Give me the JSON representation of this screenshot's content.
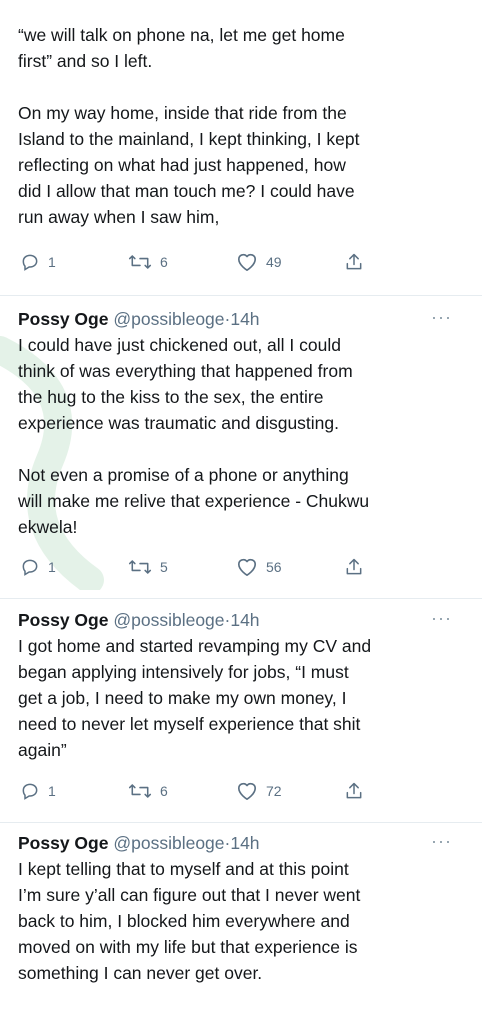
{
  "intro": {
    "line1": "“we will talk on phone na, let me get home\nfirst” and so I left.",
    "line2": "On my way home, inside that ride from the\nIsland to the mainland, I kept thinking, I kept\nreflecting on what had just happened, how\ndid I allow that man touch me? I could have\nrun away when I saw him,"
  },
  "intro_actions": {
    "replies": "1",
    "retweets": "6",
    "likes": "49"
  },
  "tweets": [
    {
      "name": "Possy Oge",
      "handle": "@possibleoge",
      "dot": "·",
      "time": "14h",
      "more": "···",
      "text": "I could have just chickened out, all I could\nthink of was everything that happened from\nthe hug to the kiss to the sex, the entire\nexperience was traumatic and disgusting.",
      "text2": "Not even a promise of a phone or anything\nwill make me relive that experience - Chukwu\nekwela!",
      "replies": "1",
      "retweets": "5",
      "likes": "56"
    },
    {
      "name": "Possy Oge",
      "handle": "@possibleoge",
      "dot": "·",
      "time": "14h",
      "more": "···",
      "text": "I got home and started revamping my CV and\nbegan applying intensively for jobs, “I must\nget a job, I need to make my own money, I\nneed to never let myself experience that shit\nagain”",
      "replies": "1",
      "retweets": "6",
      "likes": "72"
    },
    {
      "name": "Possy Oge",
      "handle": "@possibleoge",
      "dot": "·",
      "time": "14h",
      "more": "···",
      "text": "I kept telling that to myself and at this point\nI’m sure y’all can figure out that I never went\nback to him, I blocked him everywhere and\nmoved on with my life but that experience is\nsomething I can never get over."
    }
  ],
  "colors": {
    "text": "#14171a",
    "secondary": "#5b7083",
    "divider": "#e6ecf0",
    "watermark": "#2e9e4a"
  }
}
